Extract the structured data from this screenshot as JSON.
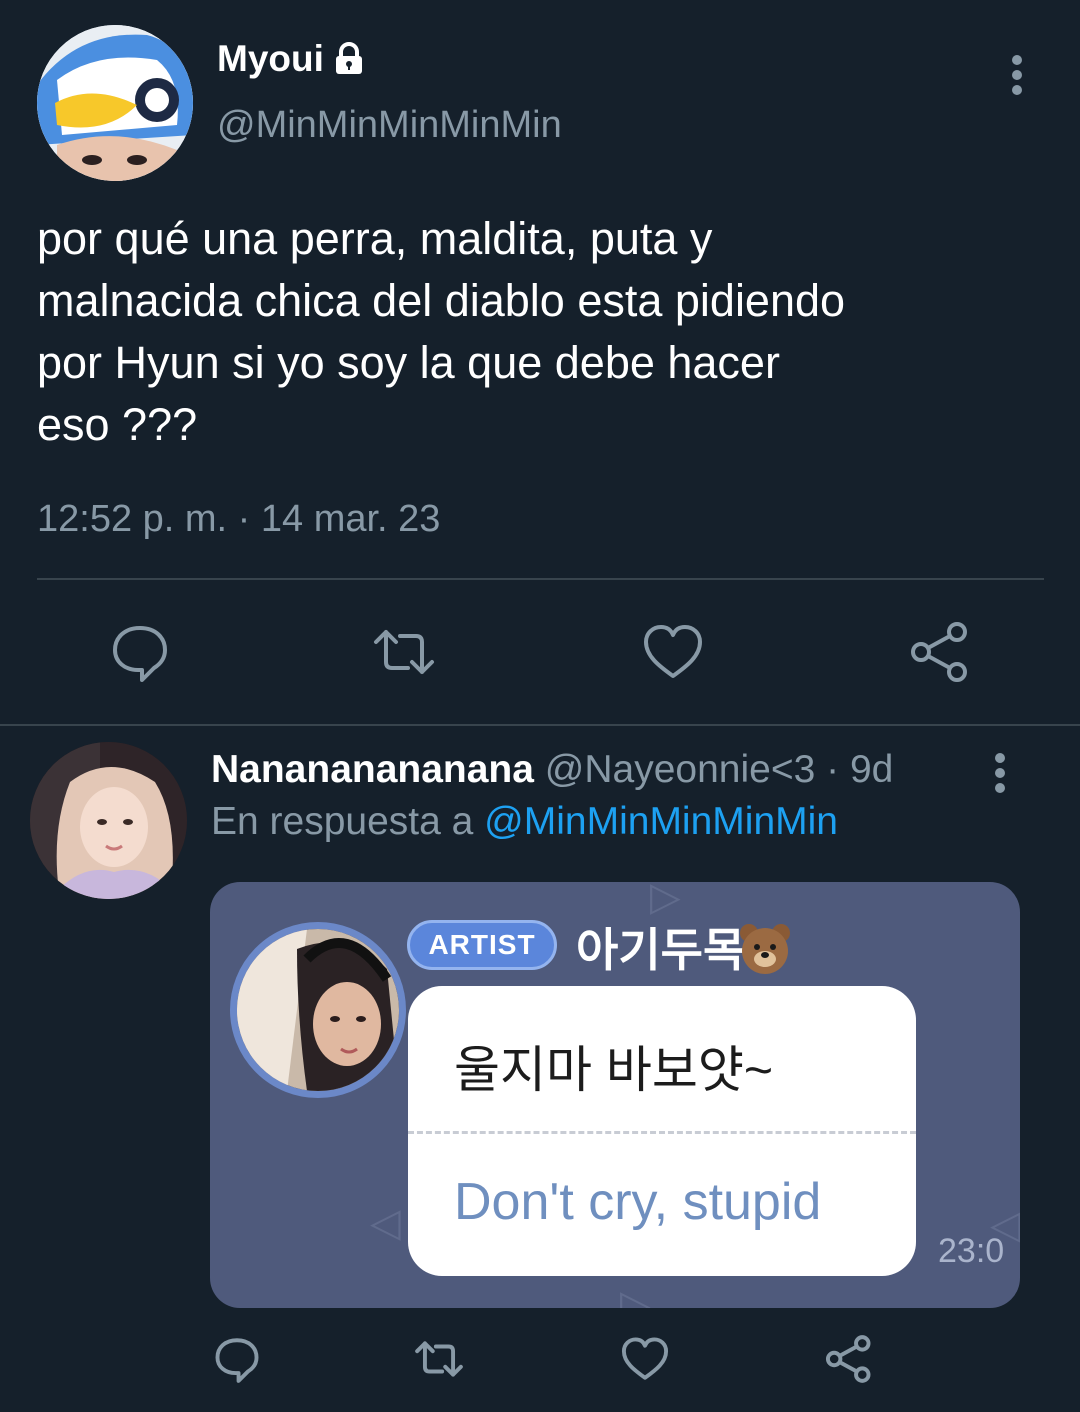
{
  "main_tweet": {
    "display_name": "Myoui",
    "handle": "@MinMinMinMinMin",
    "text": "por qué una perra, maldita, puta y\nmalnacida chica del diablo esta pidiendo\npor Hyun si yo soy la que debe hacer\neso ???",
    "timestamp": "12:52 p. m. · 14 mar. 23",
    "icons": [
      "lock-icon",
      "more-vertical-icon",
      "reply-icon",
      "retweet-icon",
      "like-icon",
      "share-icon"
    ]
  },
  "reply_tweet": {
    "display_name": "Nanananananana",
    "meta": " @Nayeonnie<3 · 9d",
    "replying_prefix": "En respuesta a ",
    "replying_to": "@MinMinMinMinMin",
    "media": {
      "badge": "ARTIST",
      "artist_name": "아기두목",
      "message_korean": "울지마 바보얏~",
      "message_english": "Don't cry, stupid",
      "time": "23:0"
    },
    "icons": [
      "more-vertical-icon",
      "reply-icon",
      "retweet-icon",
      "like-icon",
      "share-icon"
    ]
  },
  "colors": {
    "background": "#15202b",
    "secondary_text": "#8899a6",
    "accent": "#1da1f2",
    "divider": "#38444d"
  }
}
